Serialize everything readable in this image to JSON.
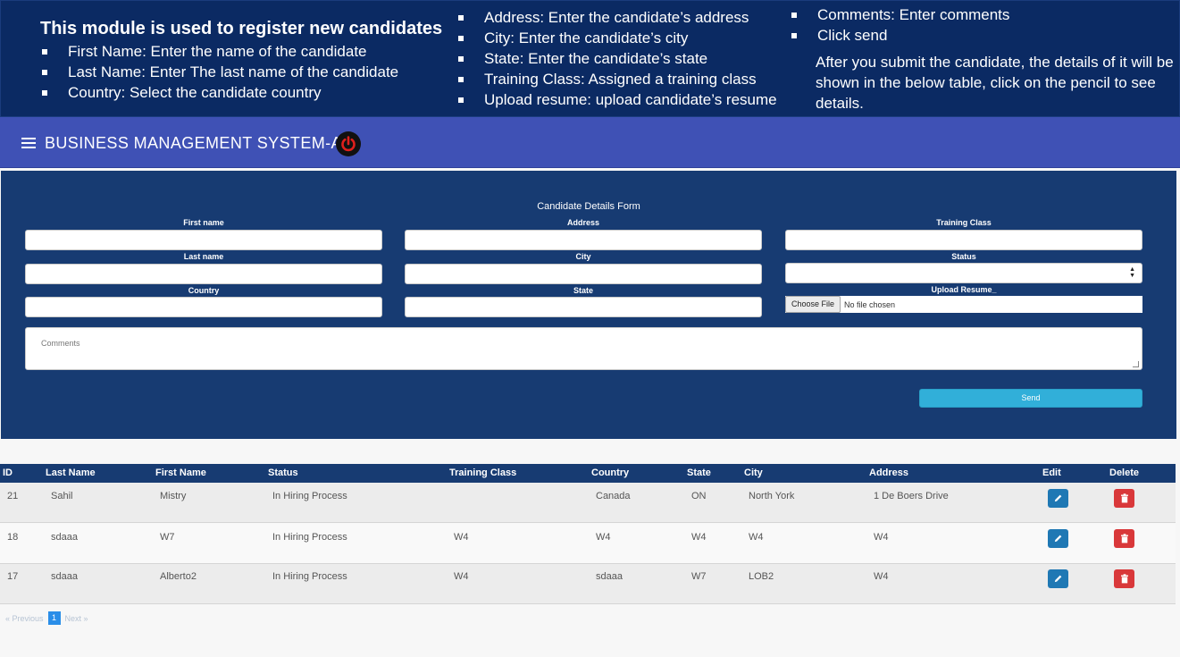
{
  "banner": {
    "heading": "This module is used to register new candidates",
    "col1": [
      "First Name: Enter the name of the candidate",
      "Last Name: Enter The last name of the candidate",
      "Country: Select the candidate country"
    ],
    "col2": [
      "Address: Enter the candidate’s address",
      "City: Enter the candidate’s city",
      "State: Enter the candidate’s state",
      "Training Class: Assigned a training class",
      "Upload resume: upload candidate’s resume"
    ],
    "col3": [
      "Comments: Enter comments",
      "Click send"
    ],
    "note": "After you submit the candidate, the details of it will be shown in the below table, click on the pencil to see details."
  },
  "header": {
    "title": "BUSINESS MANAGEMENT SYSTEM-AI",
    "menu_icon": "hamburger-menu-icon",
    "power_icon": "power-icon"
  },
  "form": {
    "title": "Candidate Details Form",
    "first_name_label": "First name",
    "last_name_label": "Last name",
    "country_label": "Country",
    "address_label": "Address",
    "city_label": "City",
    "state_label": "State",
    "training_class_label": "Training Class",
    "status_label": "Status",
    "upload_label": "Upload Resume_",
    "choose_file": "Choose File",
    "no_file": "No file chosen",
    "comments_placeholder": "Comments",
    "send_label": "Send"
  },
  "table": {
    "headers": {
      "id": "ID",
      "last_name": "Last Name",
      "first_name": "First Name",
      "status": "Status",
      "training_class": "Training Class",
      "country": "Country",
      "state": "State",
      "city": "City",
      "address": "Address",
      "edit": "Edit",
      "delete": "Delete"
    },
    "rows": [
      {
        "id": "21",
        "last_name": "Sahil",
        "first_name": "Mistry",
        "status": "In Hiring Process",
        "training_class": "",
        "country": "Canada",
        "state": "ON",
        "city": "North York",
        "address": "1 De Boers Drive"
      },
      {
        "id": "18",
        "last_name": "sdaaa",
        "first_name": "W7",
        "status": "In Hiring Process",
        "training_class": "W4",
        "country": "W4",
        "state": "W4",
        "city": "W4",
        "address": "W4"
      },
      {
        "id": "17",
        "last_name": "sdaaa",
        "first_name": "Alberto2",
        "status": "In Hiring Process",
        "training_class": "W4",
        "country": "sdaaa",
        "state": "W7",
        "city": "LOB2",
        "address": "W4"
      }
    ]
  },
  "pagination": {
    "previous": "« Previous",
    "page": "1",
    "next": "Next »"
  },
  "colors": {
    "banner_bg": "#0b2a63",
    "appbar_bg": "#3f51b5",
    "panel_bg": "#173b72",
    "send_bg": "#31afd9",
    "edit_bg": "#1f78b4",
    "delete_bg": "#d9383a",
    "power_red": "#e0201c"
  }
}
